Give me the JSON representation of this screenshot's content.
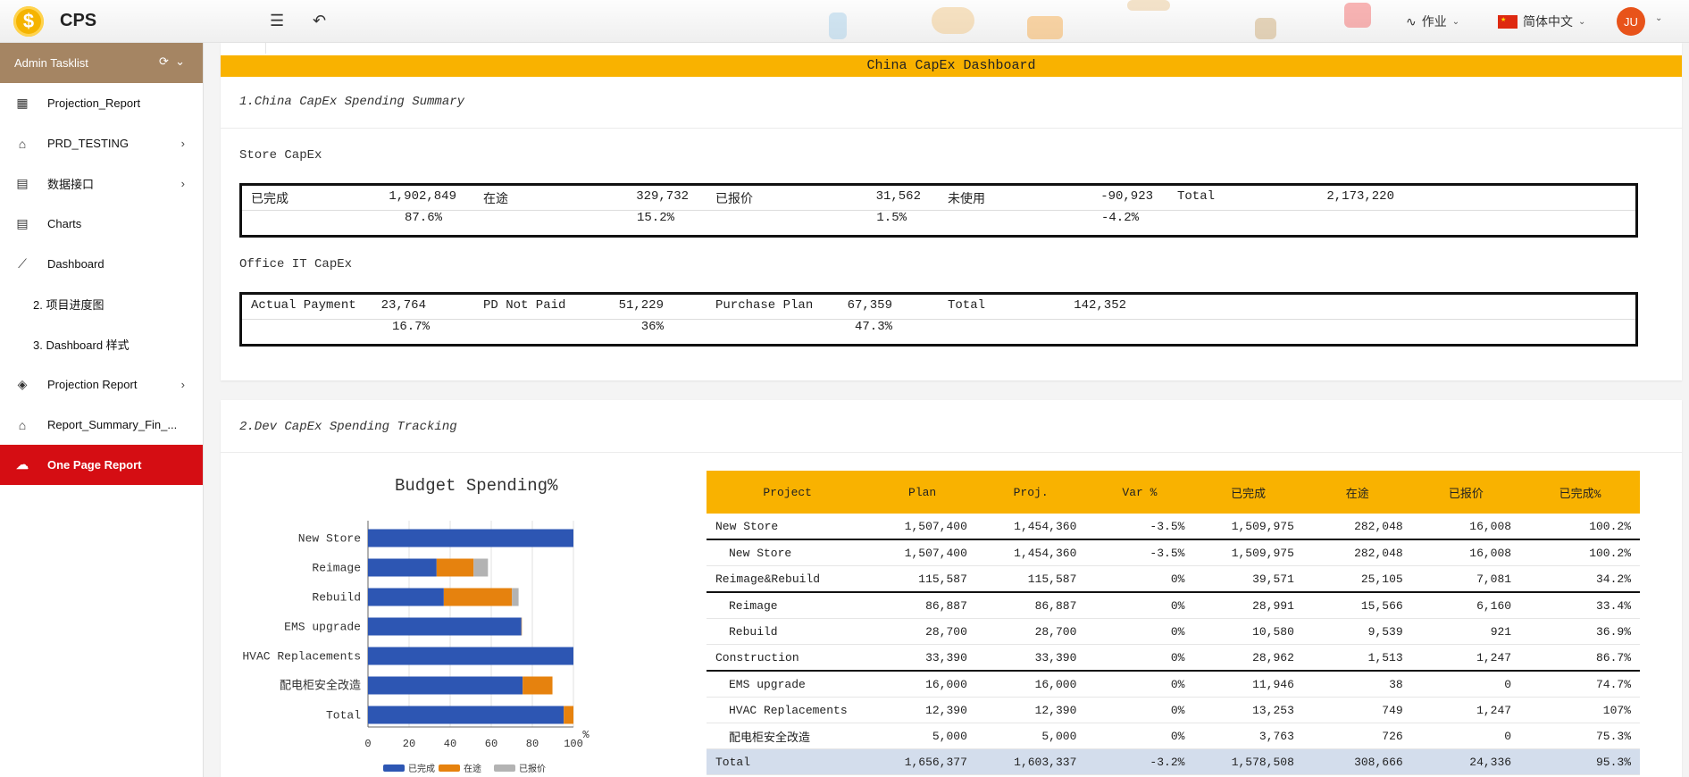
{
  "header": {
    "app_name": "CPS",
    "logo_glyph": "$",
    "menu_icon": "hamburger-icon",
    "back_icon": "back-arrow-icon",
    "work_label": "作业",
    "language_label": "简体中文",
    "avatar_initials": "JU"
  },
  "sidebar": {
    "header_label": "Admin Tasklist",
    "items": [
      {
        "label": "Projection_Report",
        "icon": "table-icon"
      },
      {
        "label": "PRD_TESTING",
        "icon": "store-icon",
        "has_children": true
      },
      {
        "label": "数据接口",
        "icon": "document-chart-icon",
        "has_children": true
      },
      {
        "label": "Charts",
        "icon": "document-chart-icon"
      },
      {
        "label": "Dashboard",
        "icon": "line-chart-icon"
      },
      {
        "label": "2. 项目进度图",
        "sub": true
      },
      {
        "label": "3. Dashboard 样式",
        "sub": true
      },
      {
        "label": "Projection Report",
        "icon": "layers-icon",
        "has_children": true
      },
      {
        "label": "Report_Summary_Fin_...",
        "icon": "store-icon"
      },
      {
        "label": "One Page Report",
        "icon": "cloud-icon",
        "active": true
      }
    ]
  },
  "dashboard_title": "China CapEx Dashboard",
  "section1": {
    "title": "1.China CapEx Spending Summary",
    "store_label": "Store CapEx",
    "store": {
      "row1": [
        {
          "label": "已完成",
          "value": "1,902,849"
        },
        {
          "label": "在途",
          "value": "329,732"
        },
        {
          "label": "已报价",
          "value": "31,562"
        },
        {
          "label": "未使用",
          "value": "-90,923"
        },
        {
          "label": "Total",
          "value": "2,173,220"
        }
      ],
      "row2": [
        "87.6%",
        "15.2%",
        "1.5%",
        "-4.2%"
      ]
    },
    "office_label": "Office IT CapEx",
    "office": {
      "row1": [
        {
          "label": "Actual Payment",
          "value": "23,764"
        },
        {
          "label": "PD Not Paid",
          "value": "51,229"
        },
        {
          "label": "Purchase Plan",
          "value": "67,359"
        },
        {
          "label": "Total",
          "value": "142,352"
        }
      ],
      "row2": [
        "16.7%",
        "36%",
        "47.3%"
      ]
    }
  },
  "section2": {
    "title": "2.Dev CapEx Spending Tracking"
  },
  "chart_data": {
    "type": "bar",
    "orientation": "horizontal",
    "stacked": true,
    "title": "Budget Spending%",
    "categories": [
      "New Store",
      "Reimage",
      "Rebuild",
      "EMS upgrade",
      "HVAC Replacements",
      "配电柜安全改造",
      "Total"
    ],
    "series": [
      {
        "name": "已完成",
        "color": "#2d56b3",
        "values": [
          100,
          33.4,
          36.9,
          74.7,
          100,
          75.3,
          95.3
        ]
      },
      {
        "name": "在途",
        "color": "#e6820e",
        "values": [
          0,
          18,
          33.2,
          0.2,
          0,
          14.5,
          4.7
        ]
      },
      {
        "name": "已报价",
        "color": "#b3b3b3",
        "values": [
          0,
          7,
          3.2,
          0,
          0,
          0,
          0
        ]
      }
    ],
    "xlim": [
      0,
      100
    ],
    "xticks": [
      0,
      20,
      40,
      60,
      80,
      100
    ],
    "xunit": "%",
    "grid": true,
    "legend_position": "bottom"
  },
  "table": {
    "headers": [
      "Project",
      "Plan",
      "Proj.",
      "Var %",
      "已完成",
      "在途",
      "已报价",
      "已完成%"
    ],
    "rows": [
      {
        "kind": "grp",
        "cells": [
          "New Store",
          "1,507,400",
          "1,454,360",
          "-3.5%",
          "1,509,975",
          "282,048",
          "16,008",
          "100.2%"
        ]
      },
      {
        "kind": "sub",
        "cells": [
          "New Store",
          "1,507,400",
          "1,454,360",
          "-3.5%",
          "1,509,975",
          "282,048",
          "16,008",
          "100.2%"
        ]
      },
      {
        "kind": "grp",
        "cells": [
          "Reimage&Rebuild",
          "115,587",
          "115,587",
          "0%",
          "39,571",
          "25,105",
          "7,081",
          "34.2%"
        ]
      },
      {
        "kind": "sub",
        "cells": [
          "Reimage",
          "86,887",
          "86,887",
          "0%",
          "28,991",
          "15,566",
          "6,160",
          "33.4%"
        ]
      },
      {
        "kind": "sub",
        "cells": [
          "Rebuild",
          "28,700",
          "28,700",
          "0%",
          "10,580",
          "9,539",
          "921",
          "36.9%"
        ]
      },
      {
        "kind": "grp",
        "cells": [
          "Construction",
          "33,390",
          "33,390",
          "0%",
          "28,962",
          "1,513",
          "1,247",
          "86.7%"
        ]
      },
      {
        "kind": "sub",
        "cells": [
          "EMS upgrade",
          "16,000",
          "16,000",
          "0%",
          "11,946",
          "38",
          "0",
          "74.7%"
        ]
      },
      {
        "kind": "sub",
        "cells": [
          "HVAC Replacements",
          "12,390",
          "12,390",
          "0%",
          "13,253",
          "749",
          "1,247",
          "107%"
        ]
      },
      {
        "kind": "sub",
        "cells": [
          "配电柜安全改造",
          "5,000",
          "5,000",
          "0%",
          "3,763",
          "726",
          "0",
          "75.3%"
        ]
      },
      {
        "kind": "total",
        "cells": [
          "Total",
          "1,656,377",
          "1,603,337",
          "-3.2%",
          "1,578,508",
          "308,666",
          "24,336",
          "95.3%"
        ]
      }
    ]
  }
}
